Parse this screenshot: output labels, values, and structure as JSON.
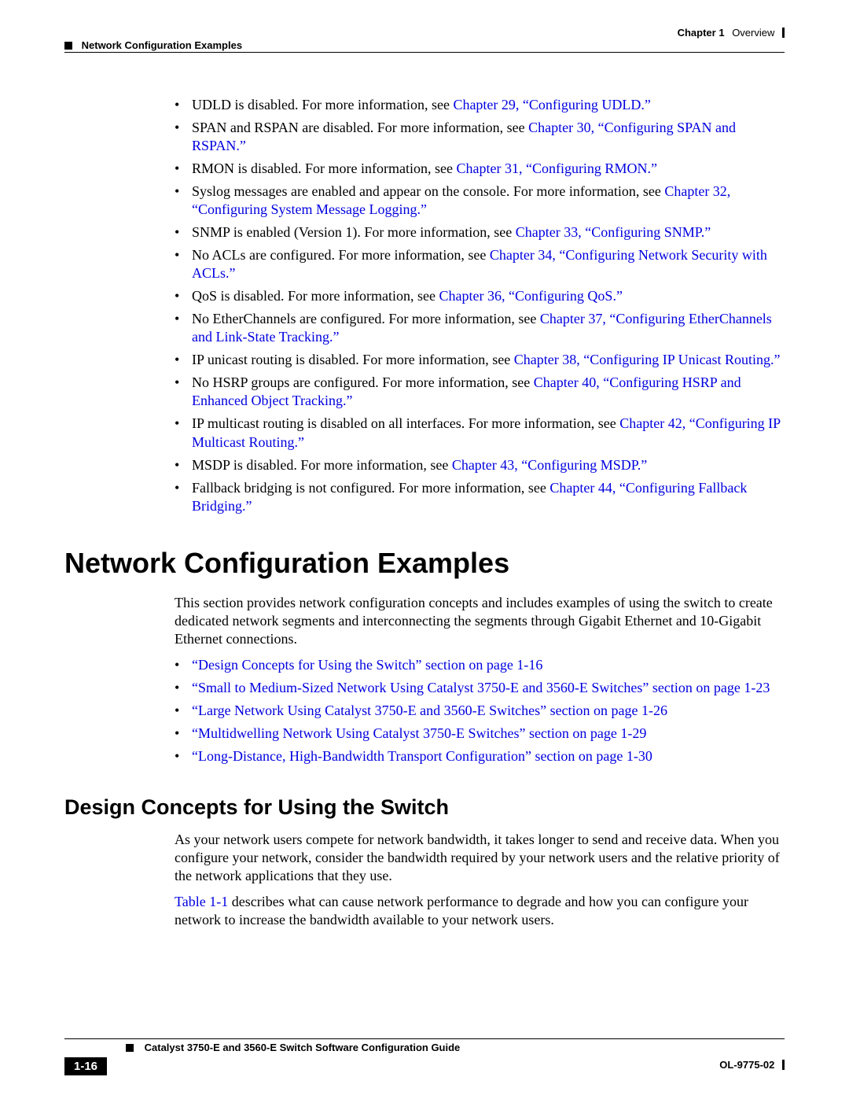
{
  "header": {
    "chapter_label": "Chapter 1",
    "chapter_title": "Overview",
    "section_title": "Network Configuration Examples"
  },
  "bullets1": [
    {
      "pre": "UDLD is disabled. For more information, see ",
      "link": "Chapter 29, “Configuring UDLD.”"
    },
    {
      "pre": "SPAN and RSPAN are disabled. For more information, see ",
      "link": "Chapter 30, “Configuring SPAN and RSPAN.”"
    },
    {
      "pre": "RMON is disabled. For more information, see ",
      "link": "Chapter 31, “Configuring RMON.”"
    },
    {
      "pre": "Syslog messages are enabled and appear on the console. For more information, see ",
      "link": "Chapter 32, “Configuring System Message Logging.”"
    },
    {
      "pre": "SNMP is enabled (Version 1). For more information, see ",
      "link": "Chapter 33, “Configuring SNMP.”"
    },
    {
      "pre": "No ACLs are configured. For more information, see ",
      "link": "Chapter 34, “Configuring Network Security with ACLs.”"
    },
    {
      "pre": "QoS is disabled. For more information, see ",
      "link": "Chapter 36, “Configuring QoS.”"
    },
    {
      "pre": "No EtherChannels are configured. For more information, see ",
      "link": "Chapter 37, “Configuring EtherChannels and Link-State Tracking.”"
    },
    {
      "pre": "IP unicast routing is disabled. For more information, see ",
      "link": "Chapter 38, “Configuring IP Unicast Routing.”"
    },
    {
      "pre": "No HSRP groups are configured. For more information, see ",
      "link": "Chapter 40, “Configuring HSRP and Enhanced Object Tracking.”"
    },
    {
      "pre": "IP multicast routing is disabled on all interfaces. For more information, see ",
      "link": "Chapter 42, “Configuring IP Multicast Routing.”"
    },
    {
      "pre": "MSDP is disabled. For more information, see ",
      "link": "Chapter 43, “Configuring MSDP.”"
    },
    {
      "pre": "Fallback bridging is not configured. For more information, see ",
      "link": "Chapter 44, “Configuring Fallback Bridging.”"
    }
  ],
  "heading1": "Network Configuration Examples",
  "para1": "This section provides network configuration concepts and includes examples of using the switch to create dedicated network segments and interconnecting the segments through Gigabit Ethernet and 10-Gigabit Ethernet connections.",
  "links2": [
    "“Design Concepts for Using the Switch” section on page 1-16",
    "“Small to Medium-Sized Network Using Catalyst 3750-E and 3560-E Switches” section on page 1-23",
    "“Large Network Using Catalyst 3750-E and 3560-E Switches” section on page 1-26",
    "“Multidwelling Network Using Catalyst 3750-E Switches” section on page 1-29",
    "“Long-Distance, High-Bandwidth Transport Configuration” section on page 1-30"
  ],
  "heading2": "Design Concepts for Using the Switch",
  "para2": "As your network users compete for network bandwidth, it takes longer to send and receive data. When you configure your network, consider the bandwidth required by your network users and the relative priority of the network applications that they use.",
  "para3_link": "Table 1-1",
  "para3_rest": " describes what can cause network performance to degrade and how you can configure your network to increase the bandwidth available to your network users.",
  "footer": {
    "guide_title": "Catalyst 3750-E and 3560-E Switch Software Configuration Guide",
    "doc_id": "OL-9775-02",
    "page_num": "1-16"
  }
}
